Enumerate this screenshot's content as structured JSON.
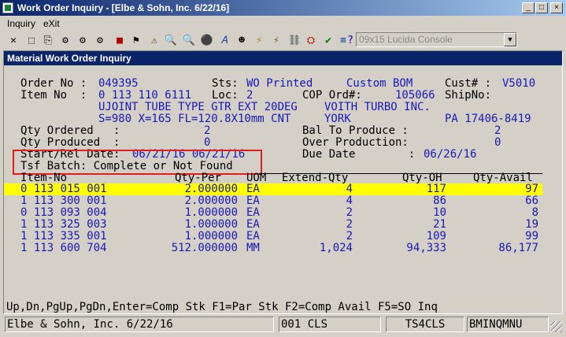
{
  "window": {
    "title": "Work Order Inquiry - [Elbe & Sohn, Inc. 6/22/16]",
    "min_glyph": "_",
    "max_glyph": "□",
    "close_glyph": "×"
  },
  "menu": {
    "inquiry": "Inquiry",
    "exit": "eXit"
  },
  "toolbar": {
    "font_select": "09x15 Lucida Console",
    "font_arrow": "▼",
    "icons": [
      "✕",
      "⬚",
      "⎘",
      "⚙",
      "⚙",
      "⚙",
      "■",
      "⚑",
      "⚠",
      "🔍",
      "⚫",
      "𝐴",
      "☻",
      "⚡",
      "⛓",
      "⛭",
      "✔",
      "≡",
      "?"
    ]
  },
  "screen_title": "Material Work Order Inquiry",
  "header": {
    "order_no_label": "Order No :",
    "order_no": "049395",
    "sts_label": "Sts:",
    "status": "WO Printed",
    "bom_type": "Custom BOM",
    "cust_label": "Cust# :",
    "cust_no": "V5010",
    "item_no_label": "Item No  :",
    "item_no": "0 113 110 6111",
    "loc_label": "Loc:",
    "loc": "2",
    "cop_label": "COP Ord#:",
    "cop_ord": "105066",
    "shipno_label": "ShipNo:",
    "description": "UJOINT TUBE TYPE GTR EXT 20DEG",
    "vendor_name": "VOITH TURBO INC.",
    "spec": "S=980 X=165 FL=120.8X10mm CNT",
    "city": "YORK",
    "state_zip": "PA 17406-8419"
  },
  "quantities": {
    "qty_ordered_label": "Qty Ordered   :",
    "qty_ordered": "2",
    "qty_produced_label": "Qty Produced  :",
    "qty_produced": "0",
    "start_rel_label": "Start/Rel Date:",
    "start_rel": "06/21/16 06/21/16",
    "bal_label": "Bal To Produce :",
    "bal": "2",
    "over_label": "Over Production:",
    "over": "0",
    "due_label": "Due Date        :",
    "due": "06/26/16",
    "tsf_batch": "Tsf Batch: Complete or Not Found"
  },
  "table": {
    "headers": {
      "item": "Item-No",
      "qty_per": "Qty-Per",
      "uom": "UOM",
      "extend": "Extend-Qty",
      "qty_oh": "Qty-OH",
      "qty_avail": "Qty-Avail"
    },
    "rows": [
      {
        "item": "0 113 015 001",
        "qty_per": "2.000000",
        "uom": "EA",
        "extend": "4",
        "qty_oh": "117",
        "qty_avail": "97"
      },
      {
        "item": "1 113 300 001",
        "qty_per": "2.000000",
        "uom": "EA",
        "extend": "4",
        "qty_oh": "86",
        "qty_avail": "66"
      },
      {
        "item": "0 113 093 004",
        "qty_per": "1.000000",
        "uom": "EA",
        "extend": "2",
        "qty_oh": "10",
        "qty_avail": "8"
      },
      {
        "item": "1 113 325 003",
        "qty_per": "1.000000",
        "uom": "EA",
        "extend": "2",
        "qty_oh": "21",
        "qty_avail": "19"
      },
      {
        "item": "1 113 335 001",
        "qty_per": "1.000000",
        "uom": "EA",
        "extend": "2",
        "qty_oh": "109",
        "qty_avail": "99"
      },
      {
        "item": "1 113 600 704",
        "qty_per": "512.000000",
        "uom": "MM",
        "extend": "1,024",
        "qty_oh": "94,333",
        "qty_avail": "86,177"
      }
    ]
  },
  "function_keys": "Up,Dn,PgUp,PgDn,Enter=Comp Stk F1=Par Stk F2=Comp Avail F5=SO Inq",
  "status": {
    "company": "Elbe & Sohn, Inc. 6/22/16",
    "cls": "001 CLS",
    "terminal": "TS4CLS",
    "program": "BMINQMNU"
  },
  "colors": {
    "title_bar": "#0a246a",
    "field_value": "#1818b8",
    "highlight": "#ffff00",
    "callout": "#e02020"
  }
}
